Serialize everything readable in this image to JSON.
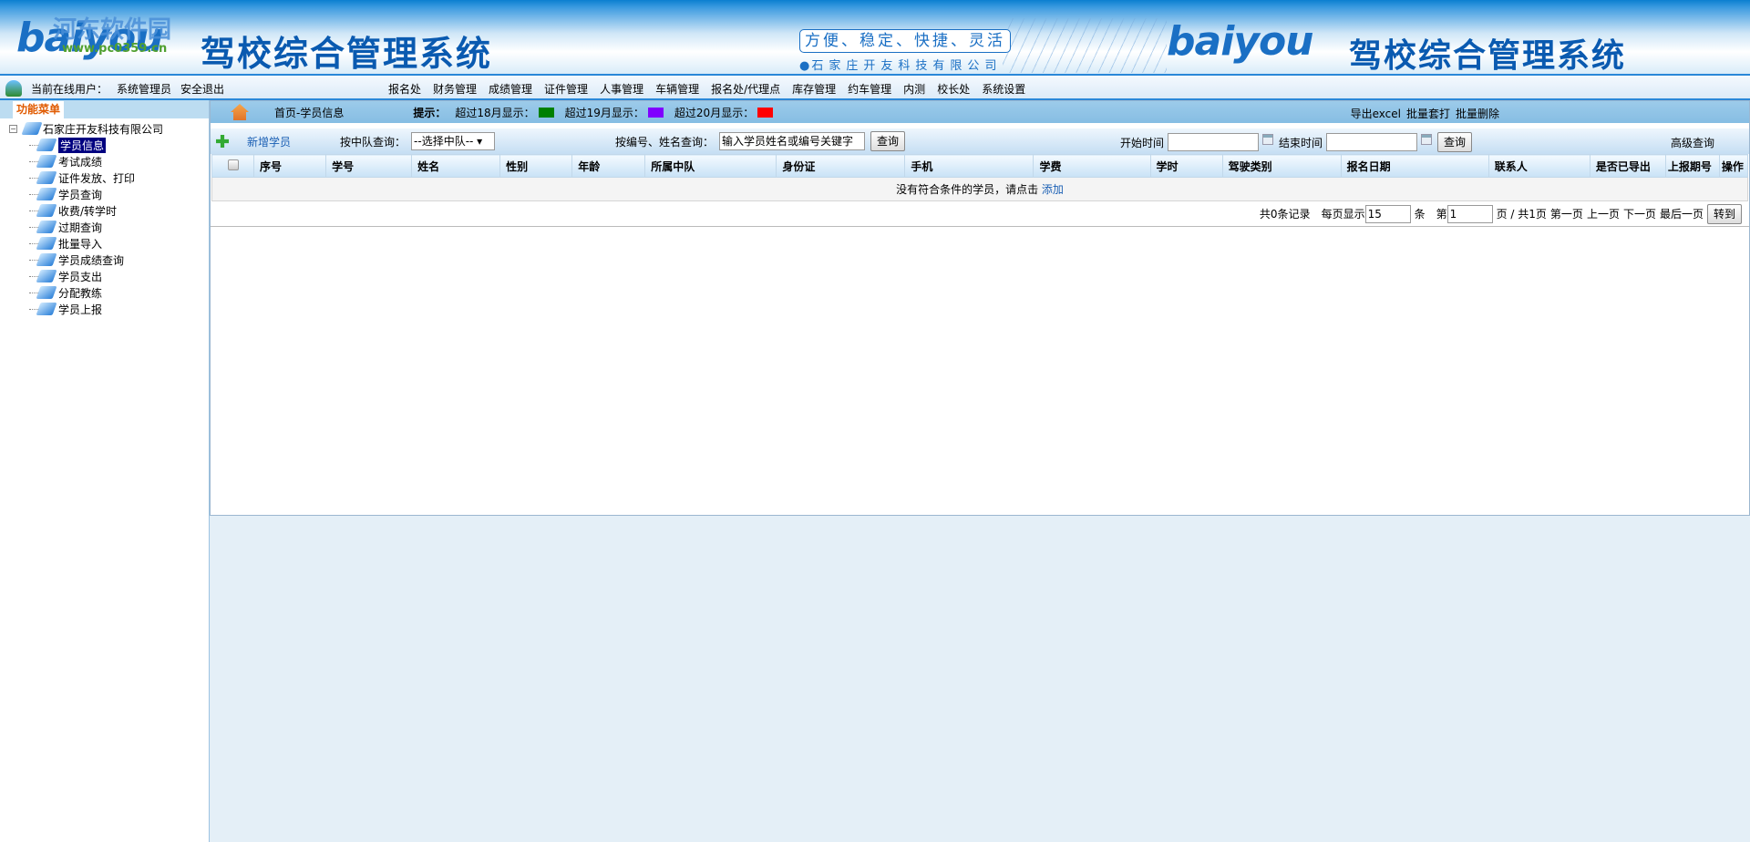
{
  "header": {
    "logo_text": "baiyou",
    "title": "驾校综合管理系统",
    "slogan": "方便、稳定、快捷、灵活",
    "company": "石家庄开友科技有限公司",
    "watermark": "河东软件园",
    "watermark_url": "www.pc0359.cn"
  },
  "navbar": {
    "online_label": "当前在线用户：",
    "user": "系统管理员",
    "logout": "安全退出",
    "menu": [
      "报名处",
      "财务管理",
      "成绩管理",
      "证件管理",
      "人事管理",
      "车辆管理",
      "报名处/代理点",
      "库存管理",
      "约车管理",
      "内测",
      "校长处",
      "系统设置"
    ]
  },
  "sidebar": {
    "header": "功能菜单",
    "root": "石家庄开友科技有限公司",
    "items": [
      "学员信息",
      "考试成绩",
      "证件发放、打印",
      "学员查询",
      "收费/转学时",
      "过期查询",
      "批量导入",
      "学员成绩查询",
      "学员支出",
      "分配教练",
      "学员上报"
    ],
    "selected": "学员信息"
  },
  "breadcrumb": "首页-学员信息",
  "hint": {
    "label": "提示：",
    "items": [
      {
        "text": "超过18月显示：",
        "color": "#008000"
      },
      {
        "text": "超过19月显示：",
        "color": "#8000ff"
      },
      {
        "text": "超过20月显示：",
        "color": "#ff0000"
      }
    ]
  },
  "ops": {
    "export": "导出excel",
    "batch_print": "批量套打",
    "batch_delete": "批量删除"
  },
  "toolbar": {
    "add": "新增学员",
    "team_label": "按中队查询：",
    "team_select": "--选择中队--",
    "name_label": "按编号、姓名查询：",
    "name_value": "输入学员姓名或编号关键字",
    "query": "查询",
    "start_label": "开始时间",
    "end_label": "结束时间",
    "start_value": "",
    "end_value": "",
    "query2": "查询",
    "advanced": "高级查询"
  },
  "table": {
    "columns": [
      "序号",
      "学号",
      "姓名",
      "性别",
      "年龄",
      "所属中队",
      "身份证",
      "手机",
      "学费",
      "学时",
      "驾驶类别",
      "报名日期",
      "联系人",
      "是否已导出",
      "上报期号",
      "操作"
    ],
    "empty_text": "没有符合条件的学员，请点击",
    "empty_link": "添加"
  },
  "pager": {
    "total": "共0条记录",
    "per_page_label": "每页显示",
    "per_page": "15",
    "unit": "条",
    "page_label": "第",
    "page": "1",
    "page_info": "页 / 共1页",
    "first": "第一页",
    "prev": "上一页",
    "next": "下一页",
    "last": "最后一页",
    "go": "转到"
  }
}
